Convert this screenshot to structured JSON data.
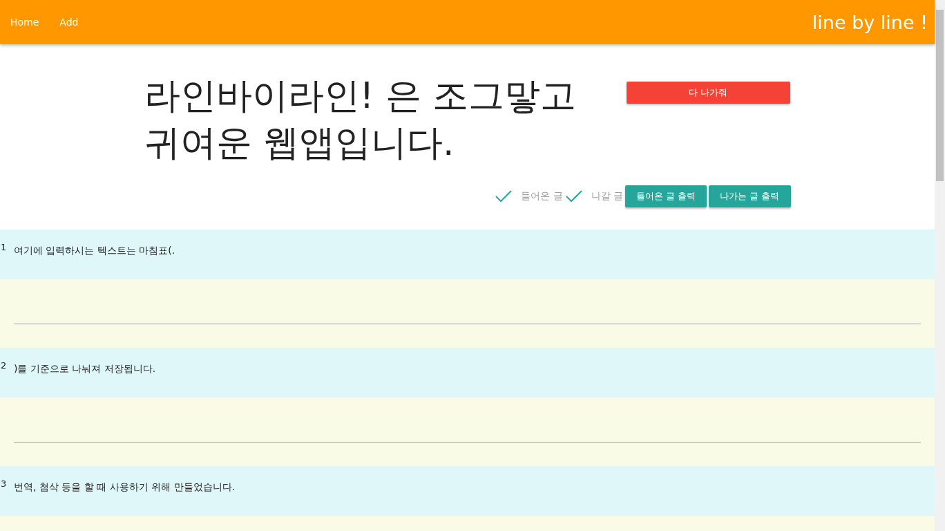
{
  "navbar": {
    "links": [
      {
        "label": "Home"
      },
      {
        "label": "Add"
      }
    ],
    "brand": "line by line !"
  },
  "header": {
    "title": "라인바이라인! 은 조그맣고 귀여운 웹앱입니다.",
    "clear_button": "다 나가줘",
    "toggles": [
      {
        "label": "들어온 글",
        "checked": true
      },
      {
        "label": "나갈 글",
        "checked": true
      }
    ],
    "buttons": [
      "들어온 글 출력",
      "나가는 글 출력"
    ]
  },
  "lines": [
    {
      "number": "1",
      "text": "여기에 입력하시는 텍스트는 마침표(."
    },
    {
      "number": "2",
      "text": ")를 기준으로 나눠져 저장됩니다."
    },
    {
      "number": "3",
      "text": "번역, 첨삭 등을 할 때 사용하기 위해 만들었습니다."
    }
  ]
}
